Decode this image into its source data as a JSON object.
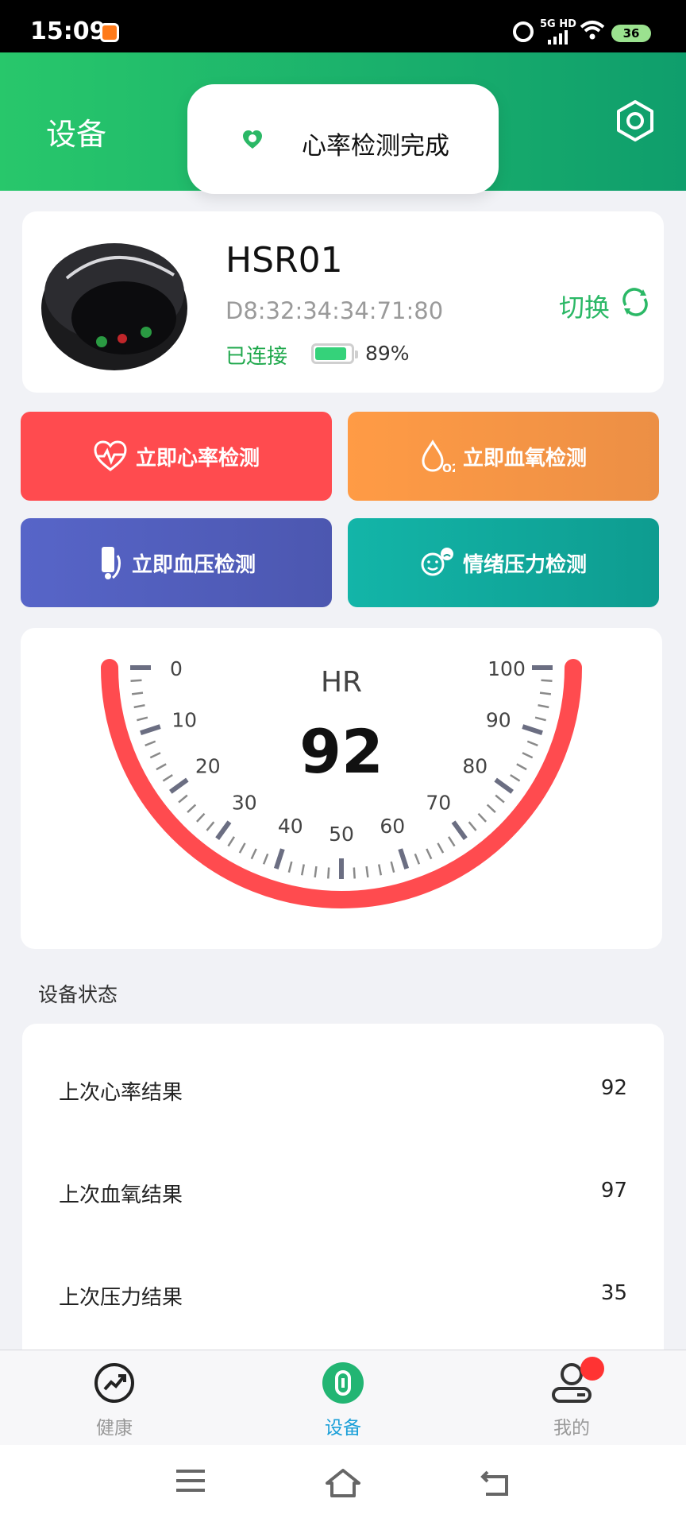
{
  "status_bar": {
    "time": "15:09",
    "network": "5G HD",
    "battery": "36"
  },
  "header": {
    "title": "设备"
  },
  "toast": {
    "message": "心率检测完成"
  },
  "device": {
    "name": "HSR01",
    "mac": "D8:32:34:34:71:80",
    "connection": "已连接",
    "battery_level": 0.89,
    "battery_text": "89%",
    "switch_label": "切换"
  },
  "actions": {
    "heart_rate": "立即心率检测",
    "blood_oxygen": "立即血氧检测",
    "blood_pressure": "立即血压检测",
    "stress": "情绪压力检测"
  },
  "gauge": {
    "label": "HR",
    "value": "92",
    "min": 0,
    "max": 100,
    "tick_labels": [
      "0",
      "10",
      "20",
      "30",
      "40",
      "50",
      "60",
      "70",
      "80",
      "90",
      "100"
    ],
    "arc_color": "#ff4b4f"
  },
  "device_status": {
    "title": "设备状态",
    "rows": [
      {
        "label": "上次心率结果",
        "value": "92"
      },
      {
        "label": "上次血氧结果",
        "value": "97"
      },
      {
        "label": "上次压力结果",
        "value": "35"
      }
    ]
  },
  "tabs": {
    "health": "健康",
    "device": "设备",
    "mine": "我的"
  },
  "colors": {
    "brand_green": "#28c76b",
    "accent_blue": "#1a9fd8"
  }
}
